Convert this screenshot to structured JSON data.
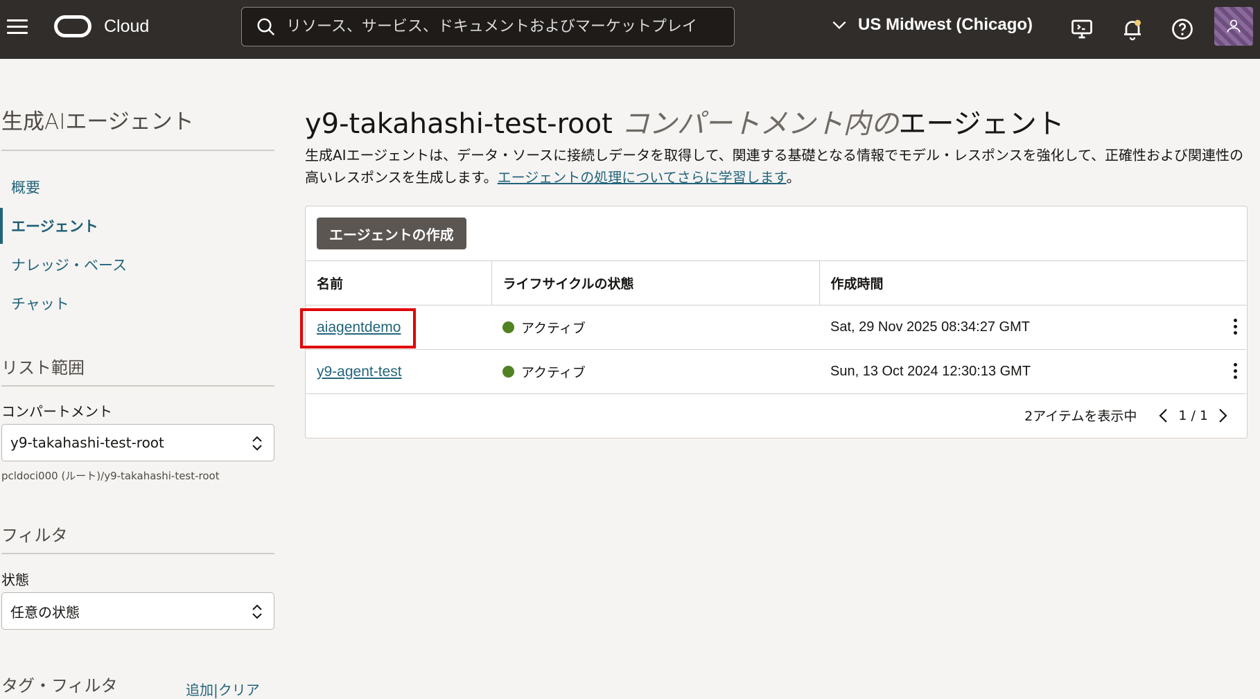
{
  "header": {
    "brand": "Cloud",
    "search_placeholder": "リソース、サービス、ドキュメントおよびマーケットプレイ",
    "region": "US Midwest (Chicago)"
  },
  "sidebar": {
    "title": "生成AIエージェント",
    "nav": [
      {
        "label": "概要"
      },
      {
        "label": "エージェント",
        "active": true
      },
      {
        "label": "ナレッジ・ベース"
      },
      {
        "label": "チャット"
      }
    ],
    "list_scope": "リスト範囲",
    "compartment_label": "コンパートメント",
    "compartment_value": "y9-takahashi-test-root",
    "compartment_path": "pcldoci000 (ルート)/y9-takahashi-test-root",
    "filter_section": "フィルタ",
    "state_label": "状態",
    "state_value": "任意の状態",
    "tag_filter": "タグ・フィルタ",
    "tag_links": "追加|クリア"
  },
  "main": {
    "title_name": "y9-takahashi-test-root",
    "title_mid": " コンパートメント内の",
    "title_end": "エージェント",
    "description": "生成AIエージェントは、データ・ソースに接続しデータを取得して、関連する基礎となる情報でモデル・レスポンスを強化して、正確性および関連性の高いレスポンスを生成します。",
    "learn_more": "エージェントの処理についてさらに学習します",
    "learn_more_suffix": "。",
    "create_button": "エージェントの作成",
    "columns": [
      "名前",
      "ライフサイクルの状態",
      "作成時間"
    ],
    "rows": [
      {
        "name": "aiagentdemo",
        "state": "アクティブ",
        "created": "Sat, 29 Nov 2025 08:34:27 GMT"
      },
      {
        "name": "y9-agent-test",
        "state": "アクティブ",
        "created": "Sun, 13 Oct 2024 12:30:13 GMT"
      }
    ],
    "item_count": "2アイテムを表示中",
    "page_indicator": "1 / 1"
  },
  "colors": {
    "header_bg": "#312d2a",
    "link": "#22647a",
    "active_status": "#508223",
    "highlight": "#e00000"
  }
}
